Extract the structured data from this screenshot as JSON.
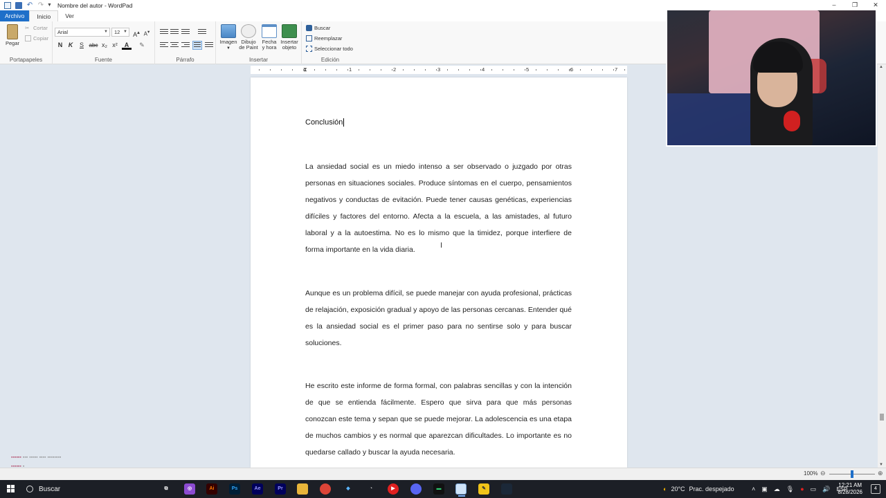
{
  "window": {
    "title": "Nombre del autor - WordPad",
    "controls": [
      "–",
      "❐",
      "✕"
    ]
  },
  "tabs": {
    "file": "Archivo",
    "home": "Inicio",
    "view": "Ver"
  },
  "ribbon": {
    "clipboard": {
      "label": "Portapapeles",
      "paste": "Pegar",
      "cut": "Cortar",
      "copy": "Copiar"
    },
    "font": {
      "label": "Fuente",
      "family": "Arial",
      "size": "12",
      "bold": "N",
      "italic": "K",
      "underline": "S",
      "strike": "abc",
      "subscript": "x₂",
      "superscript": "x²"
    },
    "paragraph": {
      "label": "Párrafo"
    },
    "insert": {
      "label": "Insertar",
      "image": "Imagen",
      "paint1": "Dibujo",
      "paint2": "de Paint",
      "date1": "Fecha",
      "date2": "y hora",
      "object1": "Insertar",
      "object2": "objeto"
    },
    "edit": {
      "label": "Edición",
      "find": "Buscar",
      "replace": "Reemplazar",
      "select_all": "Seleccionar todo"
    }
  },
  "ruler": {
    "numbers": [
      "1",
      "2",
      "3",
      "4",
      "5",
      "6",
      "7"
    ]
  },
  "document": {
    "heading": "Conclusión",
    "paragraphs": [
      "La ansiedad social es un miedo intenso a ser observado o juzgado por otras personas en situaciones sociales. Produce síntomas en el cuerpo, pensamientos negativos y conductas de evitación. Puede tener causas genéticas, experiencias difíciles y factores del entorno. Afecta a la escuela, a las amistades, al futuro laboral y a la autoestima. No es lo mismo que la timidez, porque interfiere de forma importante en la vida diaria.",
      "Aunque es un problema difícil, se puede manejar con ayuda profesional, prácticas de relajación, exposición gradual y apoyo de las personas cercanas. Entender qué es la ansiedad social es el primer paso para no sentirse solo y para buscar soluciones.",
      "He escrito este informe de forma formal, con palabras sencillas y con la intención de que se entienda fácilmente. Espero que sirva para que más personas conozcan este tema y sepan que se puede mejorar. La adolescencia es una etapa de muchos cambios y es normal que aparezcan dificultades. Lo importante es no quedarse callado y buscar la ayuda necesaria."
    ]
  },
  "status": {
    "zoom": "100%",
    "zoom_level_percent": 100
  },
  "taskbar": {
    "search": "Buscar",
    "weather": "20°C",
    "weather_desc": "Prac. despejado",
    "language": "ESP",
    "time": "12:21 AM",
    "date": "8/28/2026",
    "notifications": "4"
  },
  "colors": {
    "accent": "#1e6fc9",
    "taskbar": "#1c1f26",
    "doc_bg": "#dfe6ee"
  }
}
